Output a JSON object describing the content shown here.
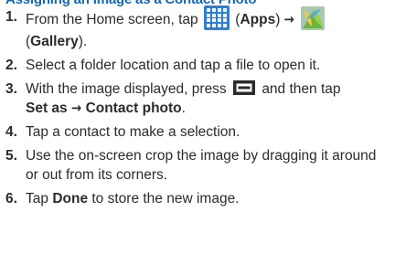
{
  "section": {
    "heading": "Assigning an Image as a Contact Photo"
  },
  "steps": [
    {
      "number": "1.",
      "parts": {
        "a": "From the Home screen, tap",
        "apps_label": "Apps",
        "arrow": "→",
        "gallery_label": "Gallery"
      }
    },
    {
      "number": "2.",
      "text": "Select a folder location and tap a file to open it."
    },
    {
      "number": "3.",
      "parts": {
        "a": "With the image displayed, press",
        "b": "and then tap",
        "set_as": "Set as",
        "arrow": "→",
        "contact_photo": "Contact photo"
      }
    },
    {
      "number": "4.",
      "text": "Tap a contact to make a selection."
    },
    {
      "number": "5.",
      "text": "Use the on-screen crop the image by dragging it around or out from its corners."
    },
    {
      "number": "6.",
      "parts": {
        "a": "Tap",
        "done": "Done",
        "b": "to store the new image."
      }
    }
  ],
  "icons": {
    "apps": "apps-grid-icon",
    "gallery": "gallery-icon",
    "menu": "menu-key-icon"
  },
  "colors": {
    "heading": "#1a66a8",
    "apps_icon": "#2f7fcf",
    "text": "#2b2b2b"
  }
}
